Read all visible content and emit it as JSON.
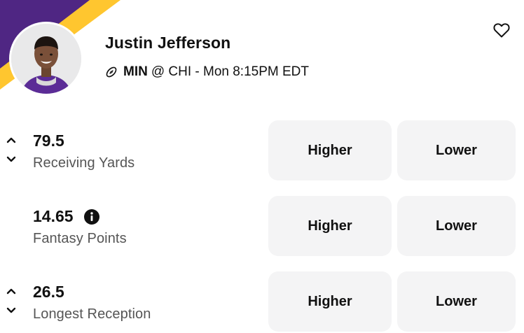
{
  "player": {
    "name": "Justin Jefferson",
    "team": "MIN",
    "matchup": "@ CHI - Mon 8:15PM EDT",
    "sport_icon": "football-icon",
    "team_colors": {
      "purple": "#4f2683",
      "gold": "#ffc62f"
    }
  },
  "favorite": {
    "icon": "heart-outline-icon"
  },
  "props": [
    {
      "value": "79.5",
      "label": "Receiving Yards",
      "has_arrows": true,
      "has_info": false,
      "higher_label": "Higher",
      "lower_label": "Lower"
    },
    {
      "value": "14.65",
      "label": "Fantasy Points",
      "has_arrows": false,
      "has_info": true,
      "higher_label": "Higher",
      "lower_label": "Lower"
    },
    {
      "value": "26.5",
      "label": "Longest Reception",
      "has_arrows": true,
      "has_info": false,
      "higher_label": "Higher",
      "lower_label": "Lower"
    }
  ],
  "colors": {
    "button_bg": "#f4f4f5",
    "label_gray": "#555555"
  }
}
